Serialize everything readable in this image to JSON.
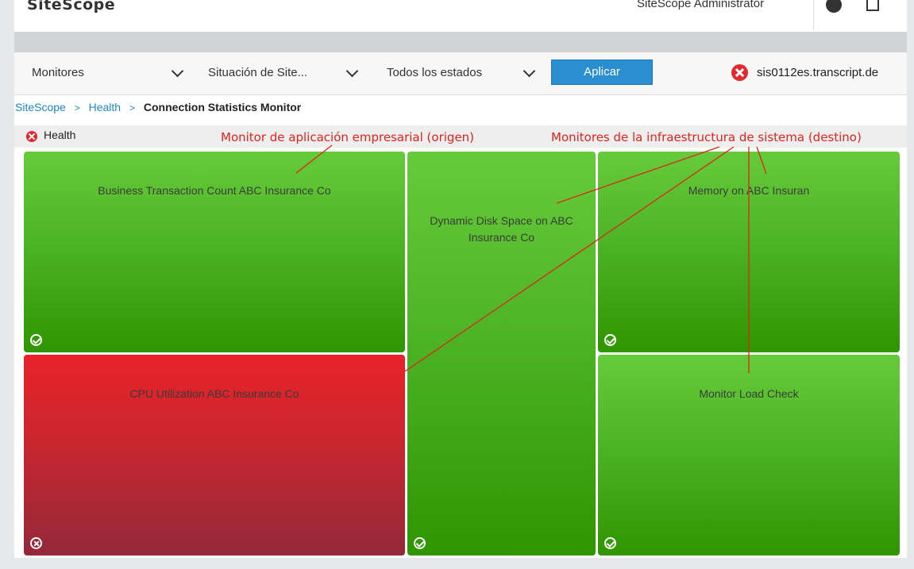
{
  "header": {
    "app_name": "SiteScope",
    "user_name": "SiteScope Administrator",
    "icons": [
      "help-icon",
      "export-icon"
    ]
  },
  "filters": {
    "view_select": "Monitores",
    "context_select": "Situación de Site...",
    "status_select": "Todos los estados",
    "apply_label": "Aplicar",
    "server_status_icon": "error-icon",
    "server_name": "sis0112es.transcript.de"
  },
  "breadcrumb": {
    "items": [
      "SiteScope",
      "Health"
    ],
    "separator": ">",
    "current": "Connection Statistics Monitor"
  },
  "health": {
    "label": "Health",
    "status": "error",
    "status_color": "#e4292e"
  },
  "tiles": [
    {
      "label": "Business Transaction Count ABC Insurance Co",
      "status": "ok",
      "color": "#4db426"
    },
    {
      "label": "Dynamic Disk Space on ABC Insurance Co",
      "status": "ok",
      "color": "#4db426"
    },
    {
      "label": "Memory on ABC Insuran",
      "status": "ok",
      "color": "#4db426"
    },
    {
      "label": "CPU Utilization ABC Insurance Co",
      "status": "error",
      "color": "#c92630"
    },
    {
      "label": "Monitor Load Check",
      "status": "ok",
      "color": "#4db426"
    }
  ],
  "annotations": {
    "source": "Monitor de aplicación empresarial (origen)",
    "target": "Monitores de la infraestructura de sistema (destino)",
    "color": "#e0231c"
  },
  "colors": {
    "accent": "#2a8fd1",
    "link": "#1a8acb",
    "ok": "#4db426",
    "error": "#e4292e"
  }
}
